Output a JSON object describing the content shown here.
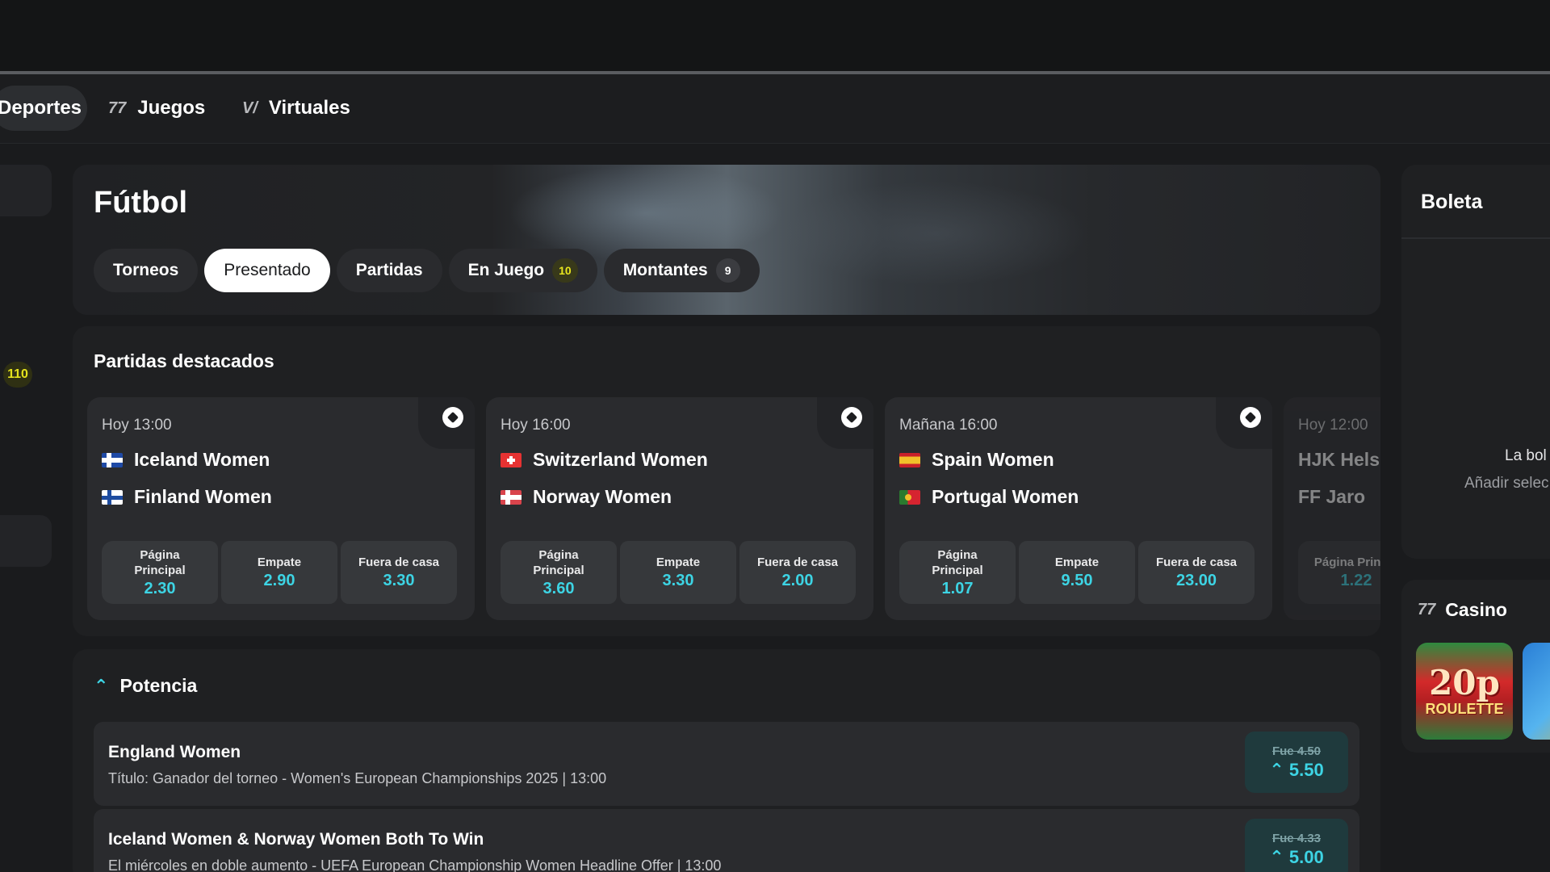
{
  "nav": {
    "items": [
      {
        "label": "Deportes",
        "icon": "sports-icon"
      },
      {
        "label": "Juegos",
        "icon": "games-icon"
      },
      {
        "label": "Virtuales",
        "icon": "virtuals-icon"
      }
    ],
    "juegos_glyph": "77",
    "virtuales_glyph": "V/"
  },
  "left_rail": {
    "badge": "110"
  },
  "hero": {
    "title": "Fútbol",
    "tabs": [
      {
        "label": "Torneos"
      },
      {
        "label": "Presentado",
        "active": true
      },
      {
        "label": "Partidas"
      },
      {
        "label": "En Juego",
        "count": "10"
      },
      {
        "label": "Montantes",
        "count": "9"
      }
    ]
  },
  "featured": {
    "title": "Partidas destacados",
    "matches": [
      {
        "time": "Hoy 13:00",
        "home": "Iceland Women",
        "away": "Finland Women",
        "odds": [
          {
            "label": "Página Principal",
            "value": "2.30"
          },
          {
            "label": "Empate",
            "value": "2.90"
          },
          {
            "label": "Fuera de casa",
            "value": "3.30"
          }
        ]
      },
      {
        "time": "Hoy 16:00",
        "home": "Switzerland Women",
        "away": "Norway Women",
        "odds": [
          {
            "label": "Página Principal",
            "value": "3.60"
          },
          {
            "label": "Empate",
            "value": "3.30"
          },
          {
            "label": "Fuera de casa",
            "value": "2.00"
          }
        ]
      },
      {
        "time": "Mañana 16:00",
        "home": "Spain Women",
        "away": "Portugal Women",
        "odds": [
          {
            "label": "Página Principal",
            "value": "1.07"
          },
          {
            "label": "Empate",
            "value": "9.50"
          },
          {
            "label": "Fuera de casa",
            "value": "23.00"
          }
        ]
      },
      {
        "time": "Hoy 12:00",
        "home": "HJK Hels",
        "away": "FF Jaro",
        "odds": [
          {
            "label": "Página Princip",
            "value": "1.22"
          }
        ]
      }
    ]
  },
  "potencia": {
    "title": "Potencia",
    "boost_glyph": "⌃",
    "rows": [
      {
        "title": "England Women",
        "subtitle": "Título: Ganador del torneo - Women's European Championships 2025 | 13:00",
        "was": "Fue 4.50",
        "now": "5.50"
      },
      {
        "title": "Iceland Women & Norway Women Both To Win",
        "subtitle": "El miércoles en doble aumento - UEFA European Championship Women Headline Offer | 13:00",
        "was": "Fue 4.33",
        "now": "5.00"
      }
    ]
  },
  "boleta": {
    "title": "Boleta",
    "empty_line1": "La bol",
    "empty_line2": "Añadir selec"
  },
  "casino": {
    "title": "Casino",
    "glyph": "77",
    "tile1_big": "20p",
    "tile1_small": "ROULETTE"
  },
  "colors": {
    "accent": "#3dd4e4",
    "live_badge": "#e8e51e",
    "background": "#1a1b1d"
  }
}
